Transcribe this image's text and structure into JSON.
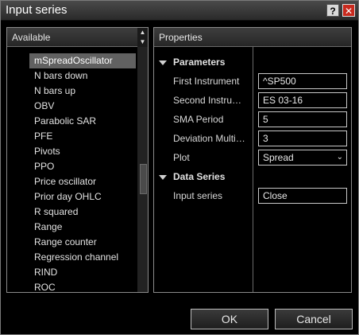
{
  "window": {
    "title": "Input series",
    "help_label": "?",
    "close_label": "✕"
  },
  "available": {
    "header": "Available",
    "scroll_up": "▲",
    "scroll_down": "▼",
    "items": [
      {
        "label": "mSpreadOscillator",
        "selected": true
      },
      {
        "label": "N bars down"
      },
      {
        "label": "N bars up"
      },
      {
        "label": "OBV"
      },
      {
        "label": "Parabolic SAR"
      },
      {
        "label": "PFE"
      },
      {
        "label": "Pivots"
      },
      {
        "label": "PPO"
      },
      {
        "label": "Price oscillator"
      },
      {
        "label": "Prior day OHLC"
      },
      {
        "label": "R squared"
      },
      {
        "label": "Range"
      },
      {
        "label": "Range counter"
      },
      {
        "label": "Regression channel"
      },
      {
        "label": "RIND"
      },
      {
        "label": "ROC"
      }
    ]
  },
  "properties": {
    "header": "Properties",
    "parameters": {
      "title": "Parameters",
      "rows": [
        {
          "label": "First Instrument",
          "value": "^SP500"
        },
        {
          "label": "Second Instru…",
          "value": "ES 03-16"
        },
        {
          "label": "SMA Period",
          "value": "5"
        },
        {
          "label": "Deviation Multi…",
          "value": "3"
        },
        {
          "label": "Plot",
          "value": "Spread",
          "dropdown": true
        }
      ]
    },
    "data_series": {
      "title": "Data Series",
      "rows": [
        {
          "label": "Input series",
          "value": "Close"
        }
      ]
    },
    "dropdown_chevron": "⌄"
  },
  "buttons": {
    "ok": "OK",
    "cancel": "Cancel"
  }
}
